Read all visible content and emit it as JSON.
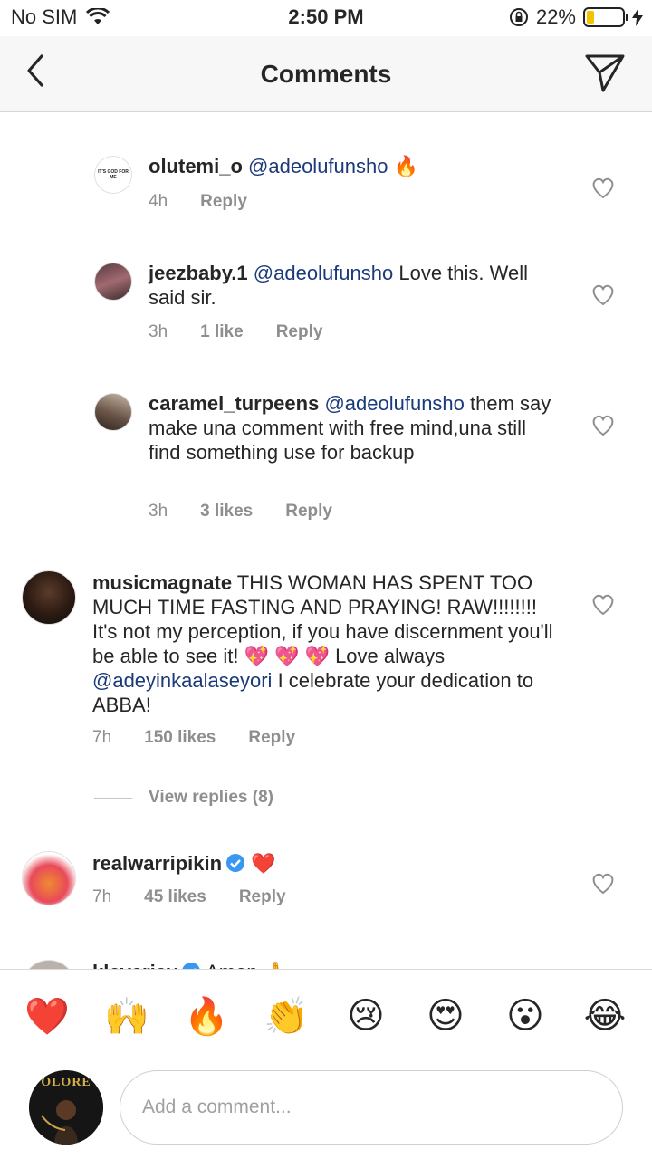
{
  "status_bar": {
    "carrier": "No SIM",
    "time": "2:50 PM",
    "battery_percent_text": "22%",
    "battery_level": 0.22,
    "battery_color": "#f4c300"
  },
  "header": {
    "title": "Comments",
    "back_icon": "chevron-left-icon",
    "send_icon": "paper-plane-icon"
  },
  "comments": [
    {
      "username": "olutemi_o",
      "mention": "@adeolufunsho",
      "text": "🔥",
      "time": "4h",
      "likes": "",
      "reply": "Reply",
      "avatar_text": "IT'S GOD FOR ME"
    },
    {
      "username": "jeezbaby.1",
      "mention": "@adeolufunsho",
      "text": "Love this. Well said sir.",
      "time": "3h",
      "likes": "1 like",
      "reply": "Reply"
    },
    {
      "username": "caramel_turpeens",
      "mention": "@adeolufunsho",
      "text": "them say make una comment with free mind,una still find something use for backup",
      "time": "3h",
      "likes": "3 likes",
      "reply": "Reply"
    },
    {
      "username": "musicmagnate",
      "text_before": "THIS WOMAN HAS SPENT TOO MUCH TIME FASTING AND PRAYING! RAW!!!!!!!! It's not my perception, if you have discernment you'll be able to see it! 💖 💖 💖 Love always",
      "mention": "@adeyinkaalaseyori",
      "text_after": "I celebrate your dedication to ABBA!",
      "time": "7h",
      "likes": "150 likes",
      "reply": "Reply"
    },
    {
      "username": "realwarripikin",
      "text": "❤️",
      "time": "7h",
      "likes": "45 likes",
      "reply": "Reply",
      "verified": true
    },
    {
      "username": "kleverjay",
      "text": "Amen 🙏",
      "verified": true
    }
  ],
  "view_replies": "View replies (8)",
  "emoji_bar": [
    "❤️",
    "🙌",
    "🔥",
    "👏",
    "😢",
    "😍",
    "😮",
    "😂"
  ],
  "input": {
    "placeholder": "Add a comment...",
    "avatar_text": "OLORE"
  },
  "colors": {
    "mention": "#1a3a7a",
    "meta": "#8e8e8e",
    "verified": "#3897f0"
  }
}
